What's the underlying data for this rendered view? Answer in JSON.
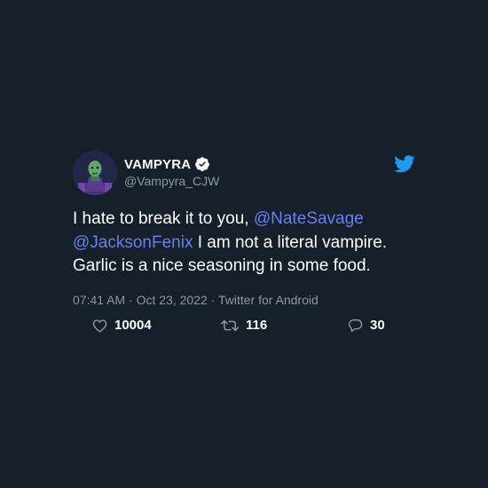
{
  "user": {
    "display_name": "VAMPYRA",
    "handle": "@Vampyra_CJW"
  },
  "tweet": {
    "text_part1": "I hate to break it to you, ",
    "mention1": "@NateSavage",
    "mention2": "@JacksonFenix",
    "text_part2": " I am not a literal vampire. Garlic is a nice seasoning in some food.",
    "meta": "07:41 AM · Oct 23, 2022 · Twitter for Android"
  },
  "stats": {
    "likes": "10004",
    "retweets": "116",
    "replies": "30"
  },
  "icons": {
    "avatar": "avatar-icon",
    "verified": "verified-badge-icon",
    "bird": "twitter-bird-icon",
    "like": "heart-icon",
    "retweet": "retweet-icon",
    "reply": "reply-bubble-icon"
  },
  "colors": {
    "background": "#15202b",
    "mention": "#6a7ff0",
    "muted": "#8b98a5",
    "brand": "#1d9bf0"
  }
}
